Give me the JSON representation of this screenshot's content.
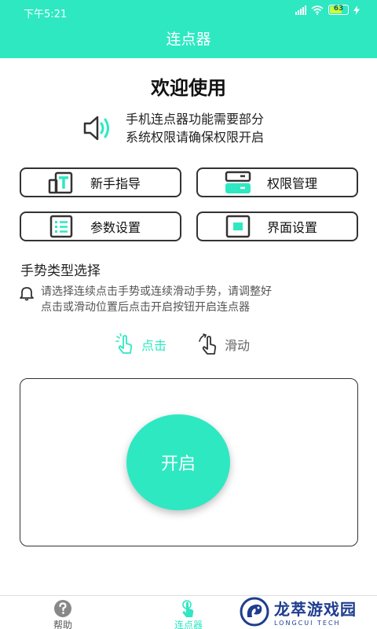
{
  "status": {
    "time": "下午5:21",
    "battery_level": "63",
    "battery_fraction": 0.63
  },
  "header": {
    "title": "连点器"
  },
  "welcome": "欢迎使用",
  "notice": {
    "line1": "手机连点器功能需要部分",
    "line2": "系统权限请确保权限开启",
    "icon": "speaker-icon"
  },
  "menu": [
    {
      "label": "新手指导",
      "icon": "guide-icon"
    },
    {
      "label": "权限管理",
      "icon": "permission-icon"
    },
    {
      "label": "参数设置",
      "icon": "list-icon"
    },
    {
      "label": "界面设置",
      "icon": "screen-icon"
    }
  ],
  "gesture": {
    "title": "手势类型选择",
    "hint_line1": "请选择连续点击手势或连续滑动手势，请调整好",
    "hint_line2": "点击或滑动位置后点击开启按钮开启连点器",
    "options": [
      {
        "label": "点击",
        "selected": true,
        "icon": "tap-hand-icon"
      },
      {
        "label": "滑动",
        "selected": false,
        "icon": "swipe-hand-icon"
      }
    ]
  },
  "start_button": "开启",
  "tabs": [
    {
      "label": "帮助",
      "icon": "help-icon",
      "active": false
    },
    {
      "label": "连点器",
      "icon": "clicker-icon",
      "active": true
    }
  ],
  "watermark": {
    "cn": "龙萃游戏园",
    "en": "LONGCUI TECH"
  },
  "colors": {
    "accent": "#2ee8c2",
    "text": "#222222",
    "watermark": "#1e3d8f"
  }
}
